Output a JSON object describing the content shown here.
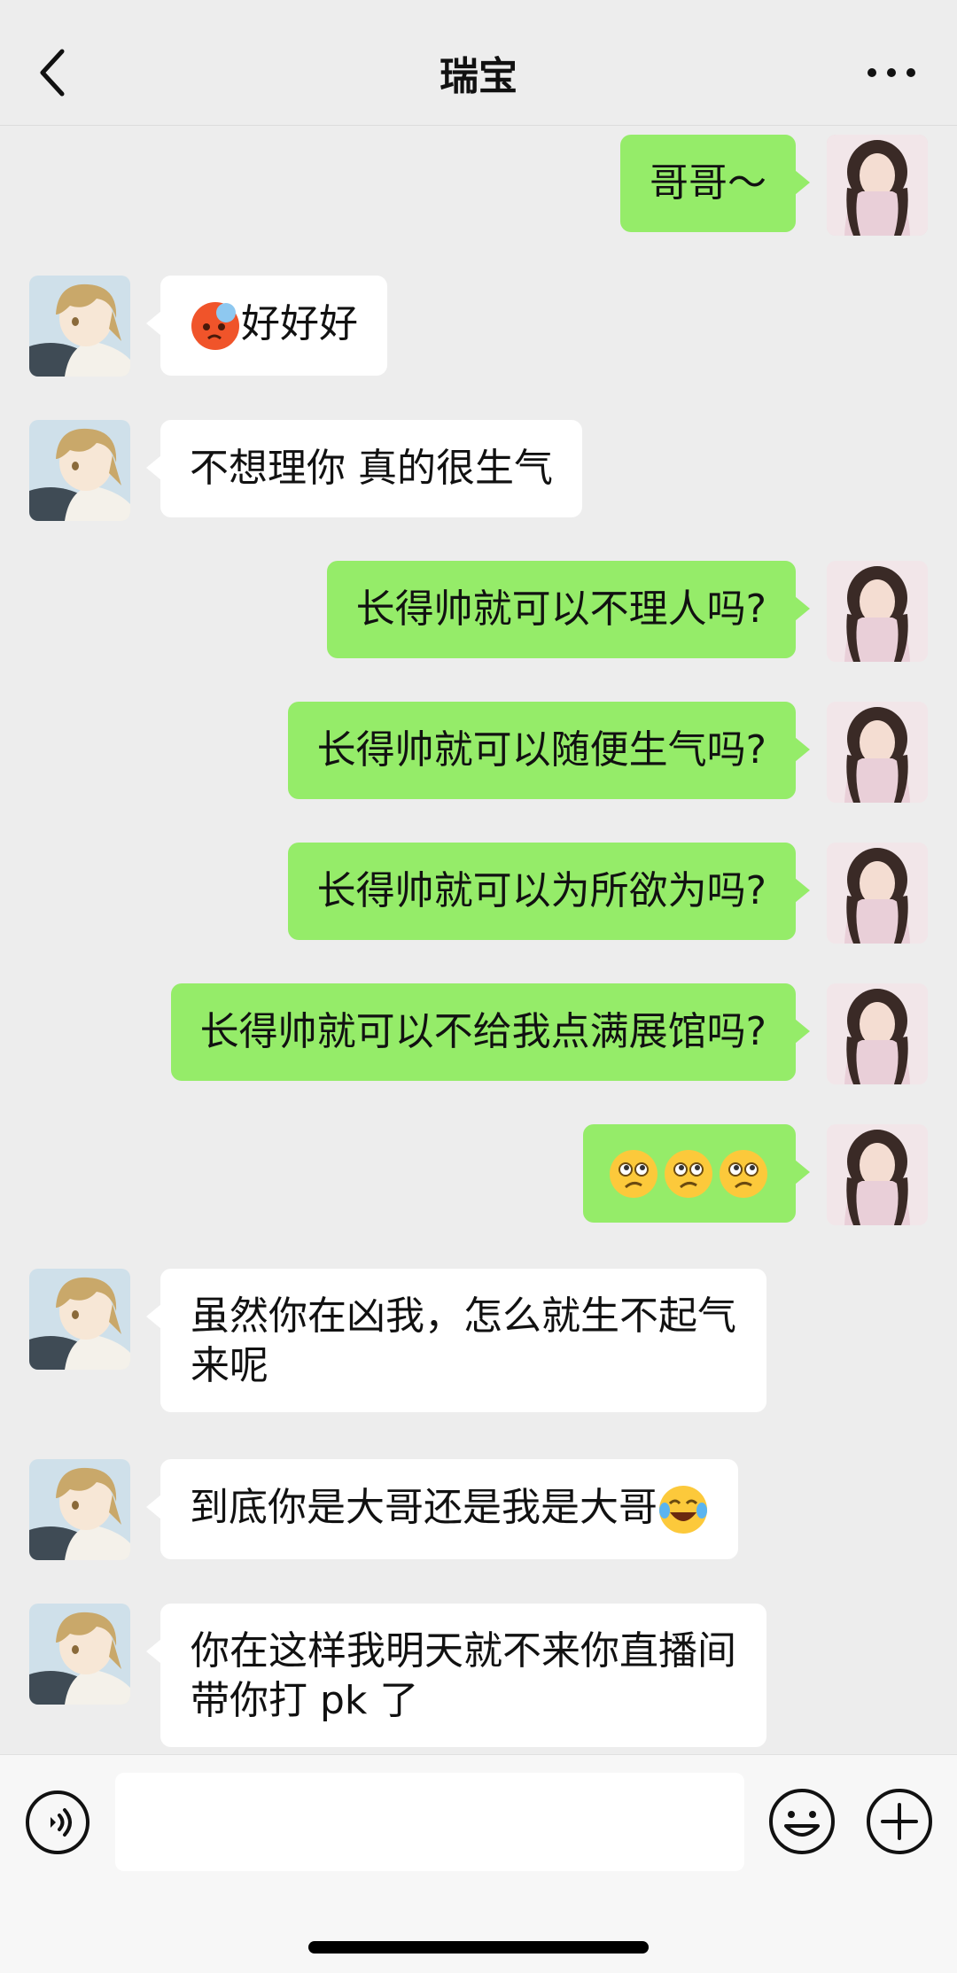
{
  "header": {
    "title": "瑞宝"
  },
  "icons": {
    "back": "chevron-left-icon",
    "more": "more-dots-icon",
    "voice": "voice-input-icon",
    "emoji": "emoji-icon",
    "plus": "plus-icon"
  },
  "colors": {
    "outgoing_bubble": "#95ec69",
    "incoming_bubble": "#ffffff",
    "background": "#ededed"
  },
  "messages": [
    {
      "side": "out",
      "text": "哥哥～"
    },
    {
      "side": "in",
      "emoji_prefix": "red-angry-face-emoji",
      "text": "好好好"
    },
    {
      "side": "in",
      "text": "不想理你 真的很生气"
    },
    {
      "side": "out",
      "text": "长得帅就可以不理人吗?"
    },
    {
      "side": "out",
      "text": "长得帅就可以随便生气吗?"
    },
    {
      "side": "out",
      "text": "长得帅就可以为所欲为吗?"
    },
    {
      "side": "out",
      "text": "长得帅就可以不给我点满展馆吗?"
    },
    {
      "side": "out",
      "emojis": [
        "confused-face-emoji",
        "confused-face-emoji",
        "confused-face-emoji"
      ]
    },
    {
      "side": "in",
      "text_lines": [
        "虽然你在凶我，怎么就生不起气",
        "来呢"
      ]
    },
    {
      "side": "in",
      "text": "到底你是大哥还是我是大哥",
      "emoji_suffix": "laughing-tears-emoji"
    },
    {
      "side": "in",
      "text_lines": [
        "你在这样我明天就不来你直播间",
        "带你打 pk 了"
      ]
    }
  ],
  "composer": {
    "input_value": ""
  }
}
